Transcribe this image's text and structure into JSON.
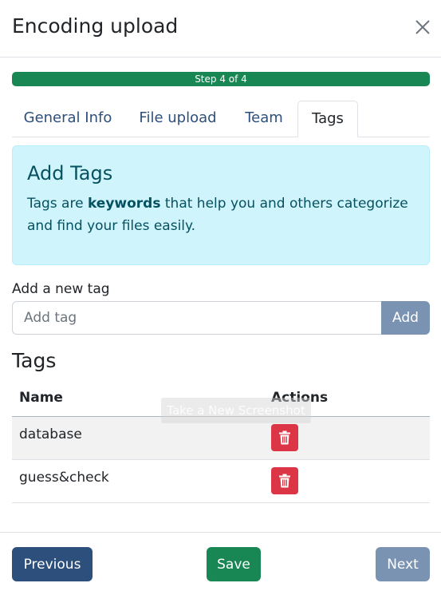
{
  "modal": {
    "title": "Encoding upload",
    "close_icon": "close-icon"
  },
  "progress": {
    "label": "Step 4 of 4",
    "value": 1.0,
    "color": "#198754"
  },
  "tabs": [
    {
      "label": "General Info",
      "active": false
    },
    {
      "label": "File upload",
      "active": false
    },
    {
      "label": "Team",
      "active": false
    },
    {
      "label": "Tags",
      "active": true
    }
  ],
  "info": {
    "heading": "Add Tags",
    "text_before": "Tags are ",
    "text_bold": "keywords",
    "text_after": " that help you and others categorize and find your files easily."
  },
  "add_tag": {
    "label": "Add a new tag",
    "placeholder": "Add tag",
    "value": "",
    "button_label": "Add"
  },
  "tags_section": {
    "heading": "Tags",
    "columns": [
      "Name",
      "Actions"
    ],
    "rows": [
      {
        "name": "database",
        "action_icon": "trash-icon"
      },
      {
        "name": "guess&check",
        "action_icon": "trash-icon"
      }
    ]
  },
  "tooltip": "Take a New Screenshot",
  "footer": {
    "previous_label": "Previous",
    "save_label": "Save",
    "next_label": "Next"
  },
  "colors": {
    "primary": "#2c4f7c",
    "success": "#198754",
    "danger": "#dc3545",
    "info_bg": "#cff4fc",
    "info_text": "#055160",
    "disabled": "#7b93b3"
  }
}
